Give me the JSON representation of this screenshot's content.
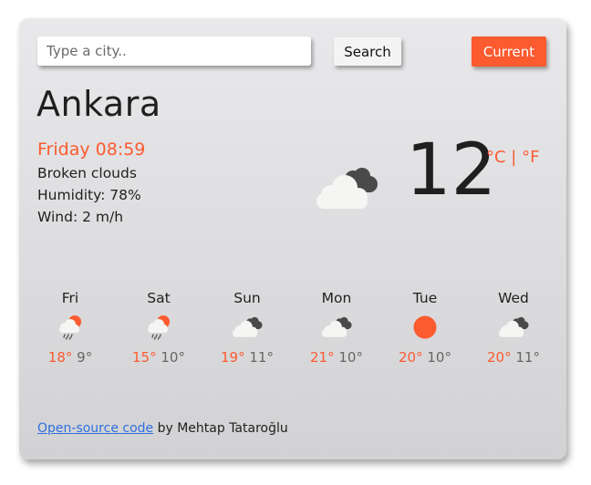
{
  "search": {
    "placeholder": "Type a city..",
    "value": ""
  },
  "buttons": {
    "search_label": "Search",
    "current_label": "Current"
  },
  "weather": {
    "city": "Ankara",
    "datetime": "Friday 08:59",
    "description": "Broken clouds",
    "humidity": "Humidity: 78%",
    "wind": "Wind: 2 m/h",
    "temperature": "12",
    "icon": "broken-clouds",
    "unit_celsius": "°C",
    "unit_separator": " | ",
    "unit_fahrenheit": "°F"
  },
  "forecast": [
    {
      "day": "Fri",
      "icon": "rain-sun",
      "max": "18°",
      "min": "9°"
    },
    {
      "day": "Sat",
      "icon": "rain-sun",
      "max": "15°",
      "min": "10°"
    },
    {
      "day": "Sun",
      "icon": "broken-clouds",
      "max": "19°",
      "min": "11°"
    },
    {
      "day": "Mon",
      "icon": "broken-clouds",
      "max": "21°",
      "min": "10°"
    },
    {
      "day": "Tue",
      "icon": "clear-sun",
      "max": "20°",
      "min": "10°"
    },
    {
      "day": "Wed",
      "icon": "broken-clouds",
      "max": "20°",
      "min": "11°"
    }
  ],
  "footer": {
    "link_text": "Open-source code",
    "author_text": " by Mehtap Tataroğlu"
  },
  "colors": {
    "accent": "#fc5a2f",
    "link": "#2f6fe0",
    "text": "#1f1f1f"
  }
}
